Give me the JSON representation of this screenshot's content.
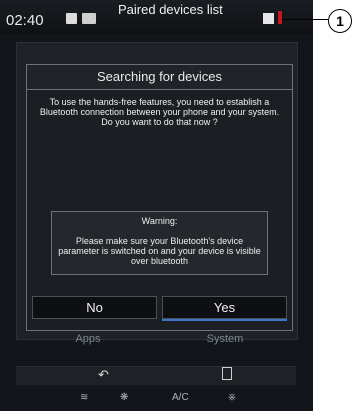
{
  "status_bar": {
    "time": "02:40",
    "title": "Paired devices list",
    "book_icon": "book-icon",
    "phone_icon": "phone-icon",
    "signal_icon": "signal-icon",
    "battery_icon": "battery-icon",
    "accent_color": "#c4161c"
  },
  "background": {
    "apps_label": "Apps",
    "system_label": "System"
  },
  "dialog": {
    "title": "Searching for devices",
    "message": "To use the hands-free features, you need to establish a Bluetooth connection between your phone and your system. Do you want to do that now ?",
    "warning_title": "Warning:",
    "warning_text": "Please make sure your Bluetooth's device parameter is switched on and your device is visible over bluetooth",
    "no_label": "No",
    "yes_label": "Yes",
    "highlight_color": "#3f73c9"
  },
  "bottom_bar": {
    "back_icon": "back-icon",
    "menu_icon": "menu-icon"
  },
  "climate_bar": {
    "seat_icon": "seat-heating-icon",
    "fan_icon": "fan-icon",
    "ac_label": "A/C",
    "defrost_icon": "defrost-icon"
  },
  "callout": {
    "number": "1"
  }
}
